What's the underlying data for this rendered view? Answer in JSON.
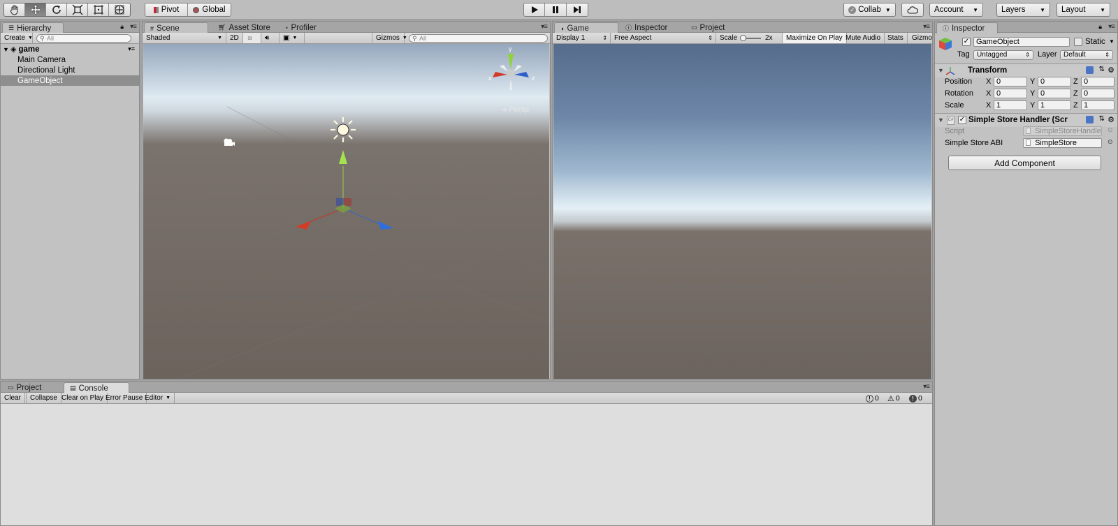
{
  "toolbar": {
    "tools": [
      "hand-tool",
      "move-tool",
      "rotate-tool",
      "scale-tool",
      "rect-tool",
      "transform-tool"
    ],
    "pivot_label": "Pivot",
    "global_label": "Global",
    "collab_label": "Collab",
    "account_label": "Account",
    "layers_label": "Layers",
    "layout_label": "Layout"
  },
  "hierarchy": {
    "tab_label": "Hierarchy",
    "create_label": "Create",
    "search_placeholder": "All",
    "scene_name": "game",
    "items": [
      {
        "label": "Main Camera",
        "selected": false
      },
      {
        "label": "Directional Light",
        "selected": false
      },
      {
        "label": "GameObject",
        "selected": true
      }
    ]
  },
  "scene": {
    "tabs": [
      "Scene",
      "Asset Store",
      "Profiler"
    ],
    "shading": "Shaded",
    "mode_2d": "2D",
    "gizmos_label": "Gizmos",
    "search_placeholder": "All",
    "persp_label": "Persp",
    "gizmo_axes": {
      "y": "y",
      "x": "x",
      "z": "z"
    }
  },
  "game": {
    "tabs": [
      "Game",
      "Inspector",
      "Project"
    ],
    "display": "Display 1",
    "aspect": "Free Aspect",
    "scale_label": "Scale",
    "scale_value": "2x",
    "maximize_label": "Maximize On Play",
    "mute_label": "Mute Audio",
    "stats_label": "Stats",
    "gizmos_label": "Gizmo"
  },
  "inspector": {
    "tab_label": "Inspector",
    "object_name": "GameObject",
    "static_label": "Static",
    "tag_label": "Tag",
    "tag_value": "Untagged",
    "layer_label": "Layer",
    "layer_value": "Default",
    "transform": {
      "title": "Transform",
      "rows": [
        {
          "label": "Position",
          "x": "0",
          "y": "0",
          "z": "0"
        },
        {
          "label": "Rotation",
          "x": "0",
          "y": "0",
          "z": "0"
        },
        {
          "label": "Scale",
          "x": "1",
          "y": "1",
          "z": "1"
        }
      ],
      "axes": [
        "X",
        "Y",
        "Z"
      ]
    },
    "script_component": {
      "title": "Simple Store Handler (Scrip",
      "script_label": "Script",
      "script_value": "SimpleStoreHandler",
      "abi_label": "Simple Store ABI",
      "abi_value": "SimpleStore"
    },
    "add_component_label": "Add Component"
  },
  "console": {
    "tabs": [
      "Project",
      "Console"
    ],
    "buttons": [
      "Clear",
      "Collapse",
      "Clear on Play",
      "Error Pause",
      "Editor"
    ],
    "counts": {
      "info": "0",
      "warning": "0",
      "error": "0"
    }
  }
}
